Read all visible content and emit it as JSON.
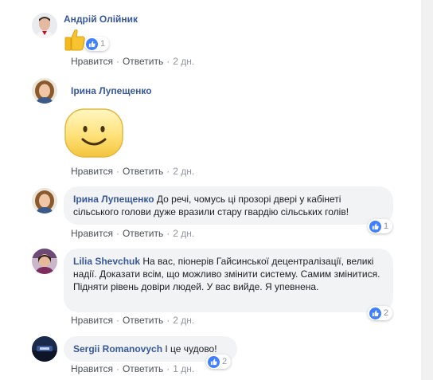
{
  "comments": [
    {
      "author": "Андрій Олійник",
      "reaction_count": "1",
      "actions": {
        "like": "Нравится",
        "reply": "Ответить",
        "time": "2 дн."
      }
    },
    {
      "author": "Ірина Лупещенко",
      "actions": {
        "like": "Нравится",
        "reply": "Ответить",
        "time": "2 дн."
      }
    },
    {
      "author": "Ірина Лупещенко",
      "text": "До речі, чомусь ці прозорі двері у кабінеті сільського голови дуже вразили стару гвардію сільських голів!",
      "reaction_count": "1",
      "actions": {
        "like": "Нравится",
        "reply": "Ответить",
        "time": "2 дн."
      }
    },
    {
      "author": "Lilia Shevchuk",
      "text": "На вас, піонерів Гайсинської децентралізації, великі надії. Доказати всім, що можливо змінити систему. Самим змінитися. Підняти рівень довіри людей. У вас вийде. Я упевнена.",
      "reaction_count": "2",
      "actions": {
        "like": "Нравится",
        "reply": "Ответить",
        "time": "2 дн."
      }
    },
    {
      "author": "Sergii Romanovych",
      "text": "І це чудово!",
      "reaction_count": "2",
      "actions": {
        "like": "Нравится",
        "reply": "Ответить",
        "time": "1 дн."
      }
    }
  ],
  "icons": {
    "thumbs_up_sticker": "thumbs-up-emoji",
    "smiley_sticker": "smiley-sticker",
    "reaction": "like-icon"
  },
  "colors": {
    "author_link": "#385898",
    "bubble_bg": "#f2f3f5",
    "like_blue": "#4080ff",
    "meta_text": "#90949c"
  }
}
